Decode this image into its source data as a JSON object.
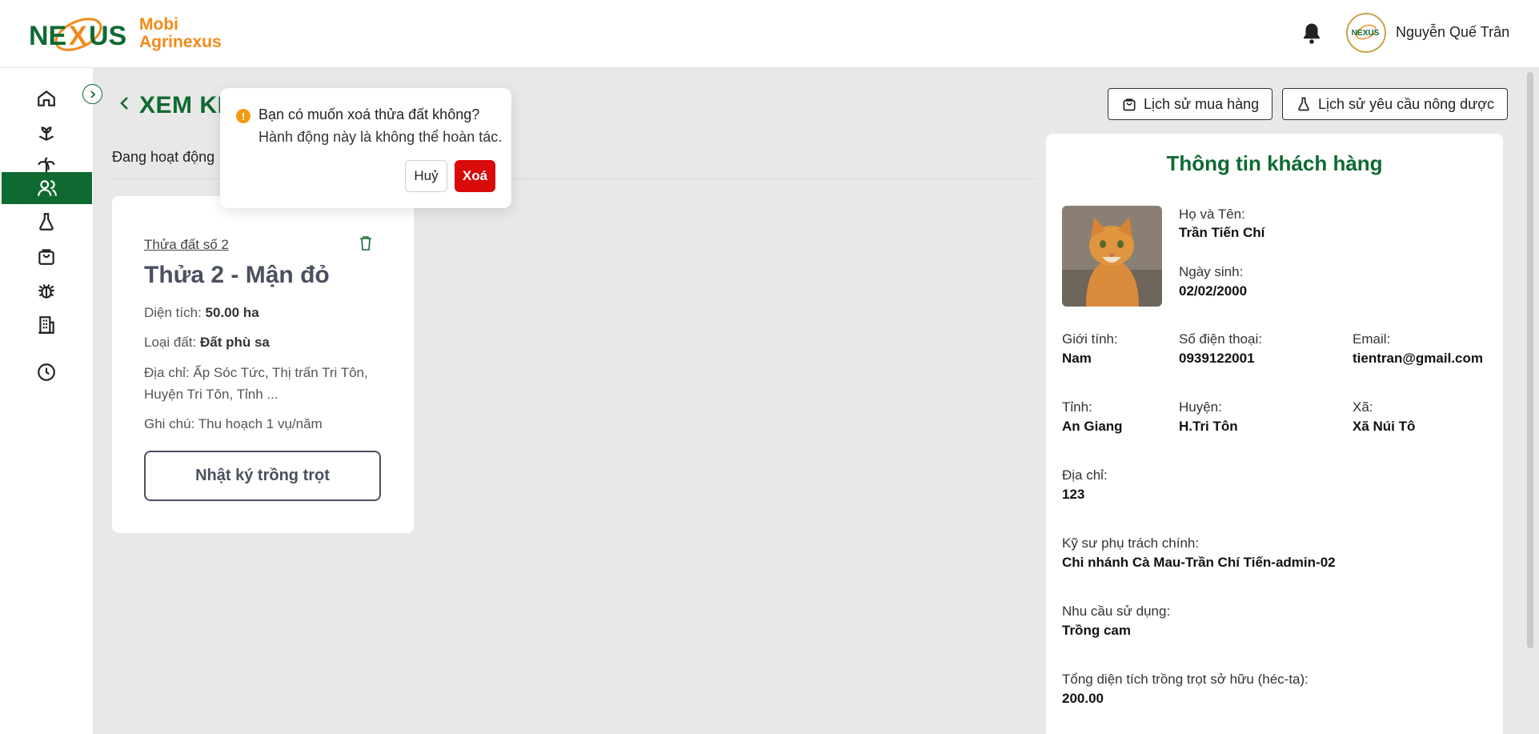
{
  "brand": {
    "line1": "Mobi",
    "line2": "Agrinexus"
  },
  "user": {
    "name": "Nguyễn Quế Trân"
  },
  "page": {
    "title": "XEM KH",
    "tab": "Đang hoạt động"
  },
  "actions": {
    "purchase_history": "Lịch sử mua hàng",
    "pesticide_history": "Lịch sử yêu cầu nông dược"
  },
  "sidebar": {
    "items": [
      {
        "icon": "home-icon"
      },
      {
        "icon": "plant-icon"
      },
      {
        "icon": "palm-tree-icon"
      },
      {
        "icon": "users-icon",
        "active": true
      },
      {
        "icon": "flask-icon"
      },
      {
        "icon": "shopping-bag-icon"
      },
      {
        "icon": "bug-icon"
      },
      {
        "icon": "building-icon"
      },
      {
        "icon": "history-icon"
      }
    ]
  },
  "land_card": {
    "link": "Thửa đất số 2",
    "title": "Thửa 2 - Mận đỏ",
    "area_label": "Diện tích:",
    "area_value": "50.00 ha",
    "soil_label": "Loại đất:",
    "soil_value": "Đất phù sa",
    "address": "Địa chỉ: Ấp Sóc Tức, Thị trấn Tri Tôn, Huyện Tri Tôn, Tỉnh ...",
    "note": "Ghi chú: Thu hoạch 1 vụ/năm",
    "diary_button": "Nhật ký trồng trọt"
  },
  "popconfirm": {
    "title": "Bạn có muốn xoá thửa đất không?",
    "description": "Hành động này là không thể hoàn tác.",
    "cancel": "Huỷ",
    "confirm": "Xoá"
  },
  "customer": {
    "title": "Thông tin khách hàng",
    "fullname_label": "Họ và Tên:",
    "fullname": "Trần Tiến Chí",
    "dob_label": "Ngày sinh:",
    "dob": "02/02/2000",
    "gender_label": "Giới tính:",
    "gender": "Nam",
    "phone_label": "Số điện thoại:",
    "phone": "0939122001",
    "email_label": "Email:",
    "email": "tientran@gmail.com",
    "province_label": "Tỉnh:",
    "province": "An Giang",
    "district_label": "Huyện:",
    "district": "H.Tri Tôn",
    "commune_label": "Xã:",
    "commune": "Xã Núi Tô",
    "address_label": "Địa chỉ:",
    "address": "123",
    "engineer_label": "Kỹ sư phụ trách chính:",
    "engineer": "Chi nhánh Cà Mau-Trần Chí Tiến-admin-02",
    "usage_label": "Nhu cầu sử dụng:",
    "usage": "Trồng cam",
    "total_area_label": "Tổng diện tích trồng trọt sở hữu (héc-ta):",
    "total_area": "200.00"
  },
  "colors": {
    "primary": "#0f6a31",
    "brand_orange": "#f28a1a",
    "danger": "#d80a0a",
    "warning": "#f59a14"
  }
}
